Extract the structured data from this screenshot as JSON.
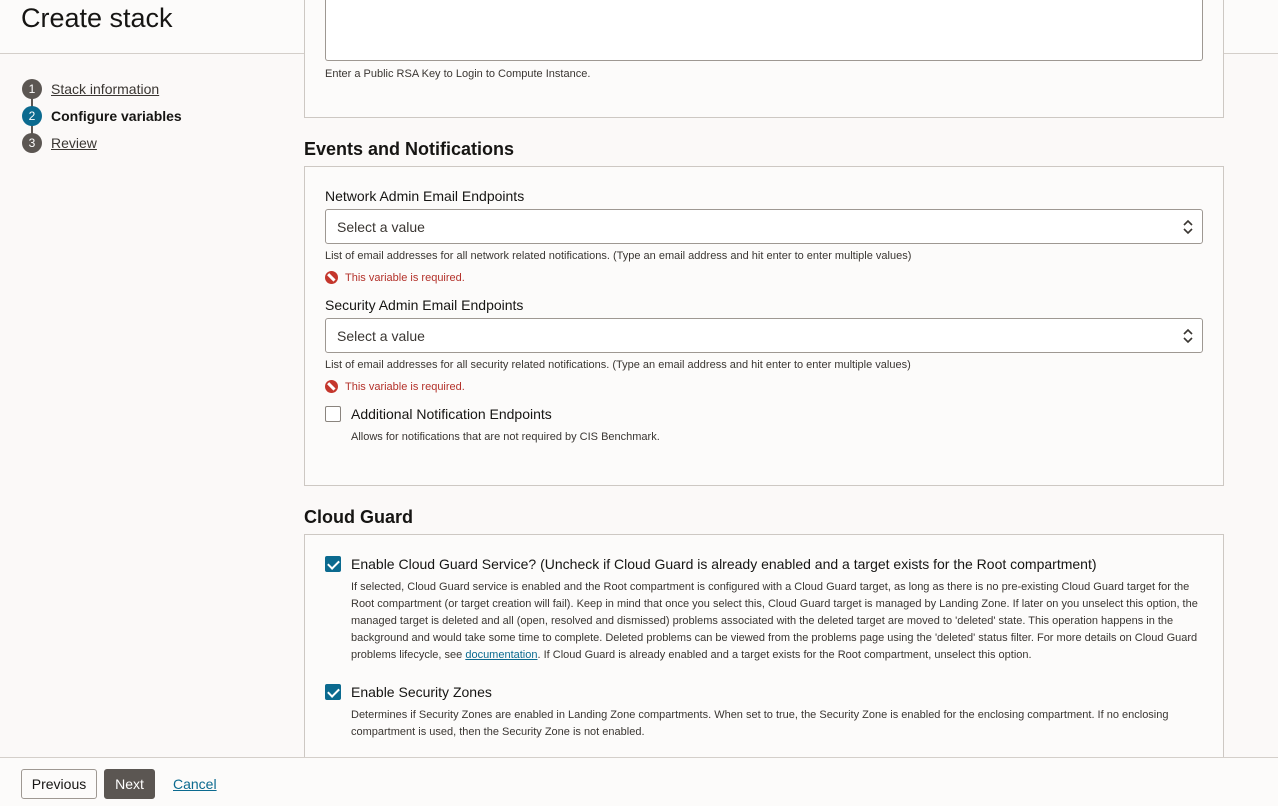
{
  "header": {
    "title": "Create stack"
  },
  "steps": [
    {
      "number": "1",
      "label": "Stack information",
      "state": "done"
    },
    {
      "number": "2",
      "label": "Configure variables",
      "state": "active"
    },
    {
      "number": "3",
      "label": "Review",
      "state": "pending"
    }
  ],
  "compute": {
    "help": "Enter a Public RSA Key to Login to Compute Instance."
  },
  "events": {
    "title": "Events and Notifications",
    "network_label": "Network Admin Email Endpoints",
    "network_placeholder": "Select a value",
    "network_help": "List of email addresses for all network related notifications. (Type an email address and hit enter to enter multiple values)",
    "network_error": "This variable is required.",
    "security_label": "Security Admin Email Endpoints",
    "security_placeholder": "Select a value",
    "security_help": "List of email addresses for all security related notifications. (Type an email address and hit enter to enter multiple values)",
    "security_error": "This variable is required.",
    "additional_label": "Additional Notification Endpoints",
    "additional_help": "Allows for notifications that are not required by CIS Benchmark.",
    "additional_checked": false
  },
  "cloud_guard": {
    "title": "Cloud Guard",
    "enable_label": "Enable Cloud Guard Service? (Uncheck if Cloud Guard is already enabled and a target exists for the Root compartment)",
    "enable_checked": true,
    "enable_help_before": "If selected, Cloud Guard service is enabled and the Root compartment is configured with a Cloud Guard target, as long as there is no pre-existing Cloud Guard target for the Root compartment (or target creation will fail). Keep in mind that once you select this, Cloud Guard target is managed by Landing Zone. If later on you unselect this option, the managed target is deleted and all (open, resolved and dismissed) problems associated with the deleted target are moved to 'deleted' state. This operation happens in the background and would take some time to complete. Deleted problems can be viewed from the problems page using the 'deleted' status filter. For more details on Cloud Guard problems lifecycle, see ",
    "enable_help_link": "documentation",
    "enable_help_after": ". If Cloud Guard is already enabled and a target exists for the Root compartment, unselect this option.",
    "zones_label": "Enable Security Zones",
    "zones_checked": true,
    "zones_help": "Determines if Security Zones are enabled in Landing Zone compartments. When set to true, the Security Zone is enabled for the enclosing compartment. If no enclosing compartment is used, then the Security Zone is not enabled."
  },
  "footer": {
    "previous_label": "Previous",
    "next_label": "Next",
    "cancel_label": "Cancel"
  },
  "colors": {
    "accent": "#0b6a8f",
    "error": "#c4362c",
    "primary_button": "#5b5652"
  }
}
